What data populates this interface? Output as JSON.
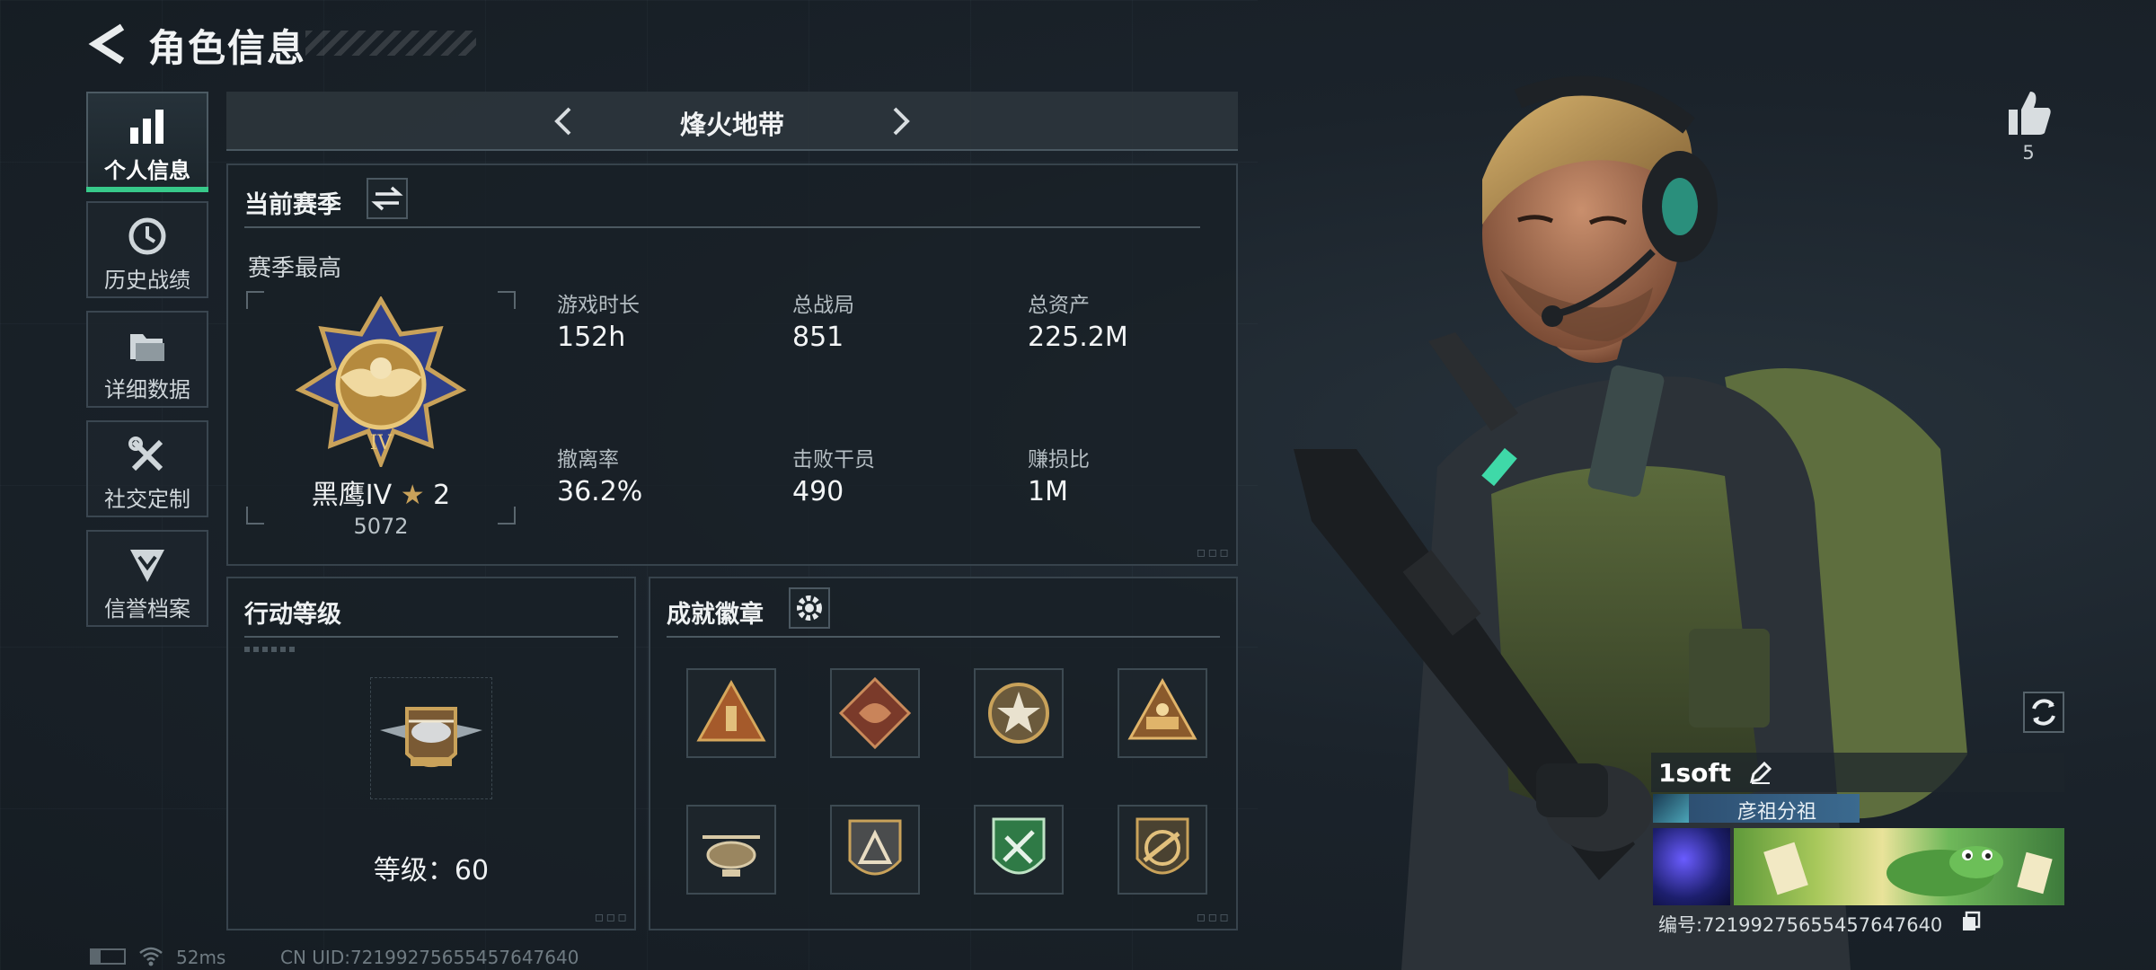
{
  "header": {
    "title": "角色信息"
  },
  "nav": [
    {
      "label": "个人信息",
      "icon": "bar-chart-icon",
      "active": true
    },
    {
      "label": "历史战绩",
      "icon": "history-clock-icon",
      "active": false
    },
    {
      "label": "详细数据",
      "icon": "folder-icon",
      "active": false
    },
    {
      "label": "社交定制",
      "icon": "wrench-tools-icon",
      "active": false
    },
    {
      "label": "信誉档案",
      "icon": "shield-chevron-icon",
      "active": false
    }
  ],
  "mode": {
    "title": "烽火地带"
  },
  "season": {
    "title": "当前赛季",
    "best_label": "赛季最高",
    "rank_name": "黑鹰IV",
    "rank_stars": "2",
    "rank_score": "5072",
    "stats": [
      {
        "label": "游戏时长",
        "value": "152h"
      },
      {
        "label": "总战局",
        "value": "851"
      },
      {
        "label": "总资产",
        "value": "225.2M"
      },
      {
        "label": "撤离率",
        "value": "36.2%"
      },
      {
        "label": "击败干员",
        "value": "490"
      },
      {
        "label": "赚损比",
        "value": "1M"
      }
    ]
  },
  "operation": {
    "title": "行动等级",
    "level_text": "等级：60"
  },
  "achievements": {
    "title": "成就徽章",
    "badges": [
      "triangle-tower-badge",
      "dragon-diamond-badge",
      "star-circle-badge",
      "triangle-rank-badge",
      "helicopter-badge",
      "triangle-shield-badge",
      "green-shield-badge",
      "gun-shield-badge"
    ]
  },
  "profile": {
    "like_count": "5",
    "player_name": "1soft",
    "title_tag": "彦祖分祖",
    "id_text": "编号:72199275655457647640"
  },
  "status_bar": {
    "ping": "52ms",
    "uid": "CN UID:72199275655457647640"
  },
  "colors": {
    "accent_green": "#37c98a",
    "panel_border": "#37434c",
    "gold": "#c9a25a"
  }
}
